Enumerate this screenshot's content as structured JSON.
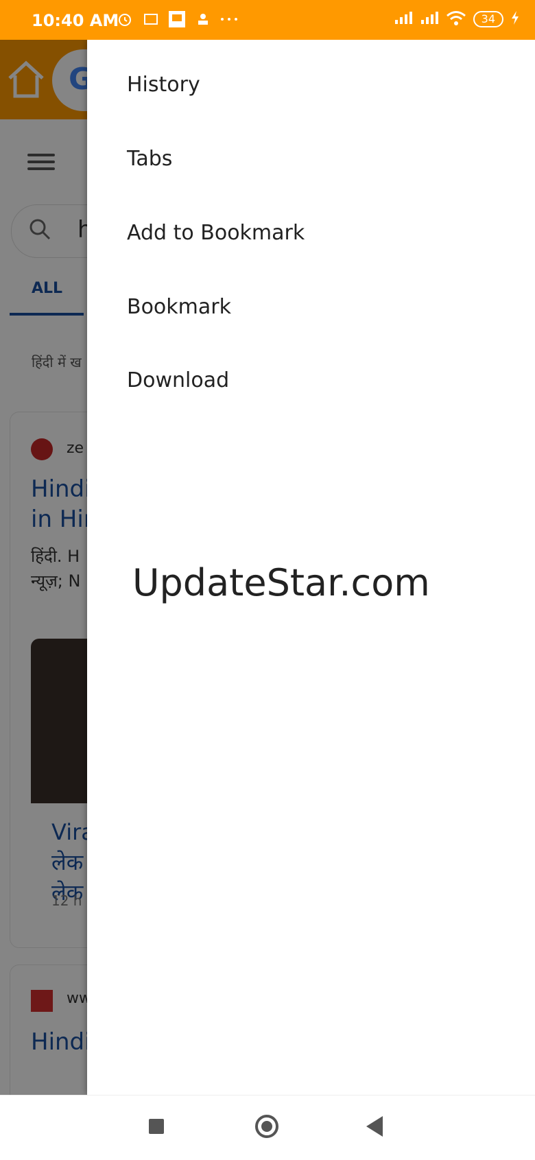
{
  "status_bar": {
    "time": "10:40 AM",
    "battery": "34",
    "left_icons": [
      "alarm-icon",
      "india-tv-icon",
      "news-app-icon",
      "hindi-news-icon",
      "more-dots-icon"
    ],
    "right_icons": [
      "signal-icon",
      "signal-icon",
      "wifi-icon",
      "battery-icon",
      "charging-icon"
    ]
  },
  "background_page": {
    "search_text": "h",
    "tab_all": "ALL",
    "snippet": "हिंदी में ख",
    "card1": {
      "source": "ze",
      "headline_line1": "Hindi",
      "headline_line2": "in Hin",
      "desc_line1": "हिंदी. H",
      "desc_line2": "न्यूज़; N",
      "headline2_line1": "Vira",
      "headline2_line2": "लेक",
      "headline2_line3": "लेक",
      "time": "12 h"
    },
    "card2": {
      "source": "ww",
      "headline": "Hindi"
    }
  },
  "drawer": {
    "items": [
      {
        "label": "History"
      },
      {
        "label": "Tabs"
      },
      {
        "label": "Add to Bookmark"
      },
      {
        "label": "Bookmark"
      },
      {
        "label": "Download"
      }
    ],
    "brand": "UpdateStar.com"
  },
  "colors": {
    "accent": "#ff9900",
    "link": "#1a4fa0"
  }
}
